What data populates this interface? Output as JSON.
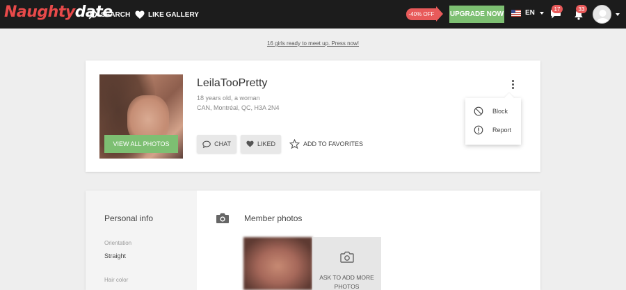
{
  "brand": {
    "logo_part1": "Naughty",
    "logo_part2": "date",
    "accent": "#e84a4a",
    "green": "#7dbf72"
  },
  "nav": {
    "search_label": "SEARCH",
    "search_icon": "search-icon",
    "like_gallery_label": "LIKE GALLERY",
    "like_gallery_icon": "heart-icon",
    "discount_label": "-40% OFF",
    "upgrade_label": "UPGRADE NOW",
    "language": "EN",
    "messages_count": "17",
    "notifications_count": "33"
  },
  "promo": {
    "text": "16 girls ready to meet up. Press now!"
  },
  "profile": {
    "username": "LeilaTooPretty",
    "age_gender": "18 years old, a woman",
    "location": "CAN, Montréal, QC, H3A 2N4",
    "view_photos_label": "VIEW ALL PHOTOS",
    "chat_label": "CHAT",
    "liked_label": "LIKED",
    "favorites_label": "ADD TO FAVORITES"
  },
  "menu": {
    "block_label": "Block",
    "report_label": "Report"
  },
  "details": {
    "section_title": "Personal info",
    "orientation_label": "Orientation",
    "orientation_value": "Straight",
    "hair_label": "Hair color",
    "photos_title": "Member photos",
    "ask_more_label": "ASK TO ADD MORE PHOTOS"
  }
}
